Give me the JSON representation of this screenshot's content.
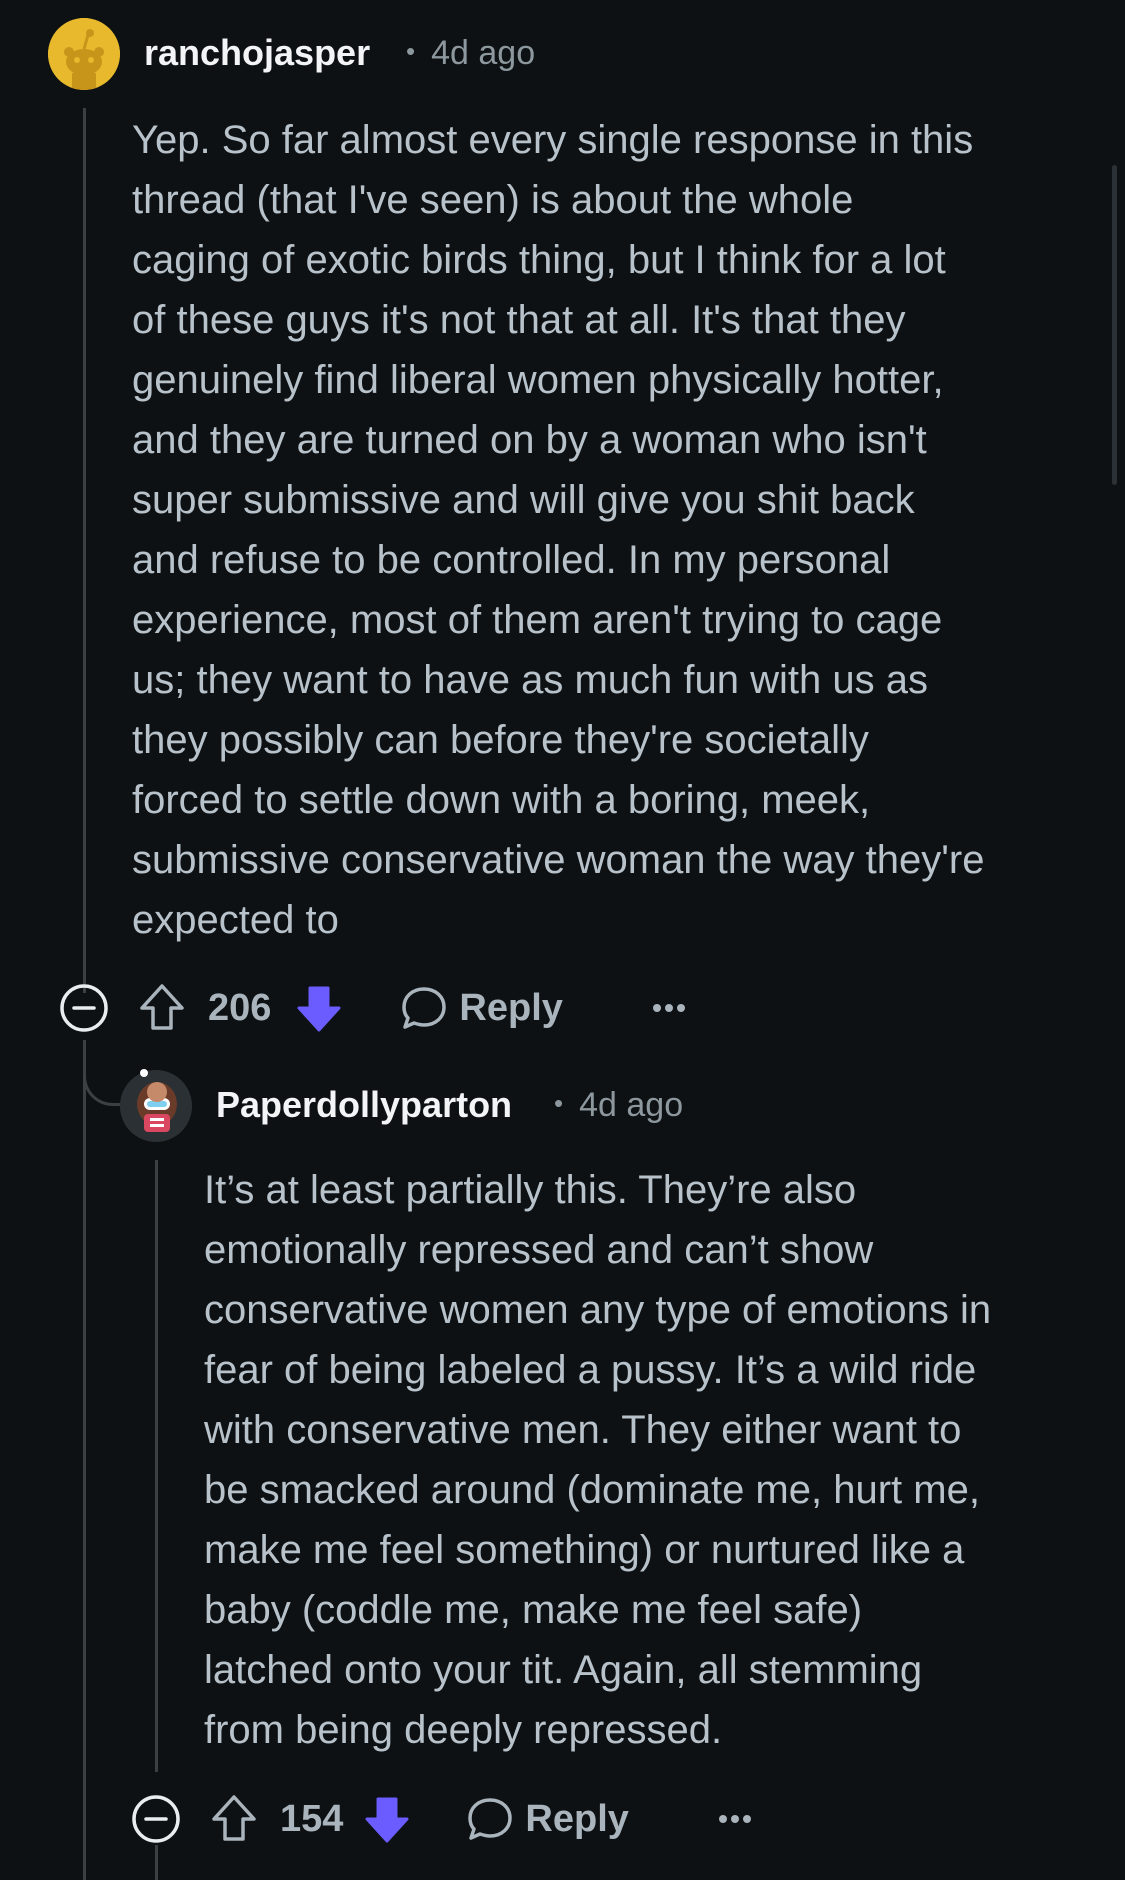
{
  "comments": [
    {
      "username": "ranchojasper",
      "time": "4d ago",
      "lines": [
        "Yep. So far almost every single response in this",
        "thread (that I've seen) is about the whole",
        "caging of exotic birds thing, but I think for a lot",
        "of these guys it's not that at all. It's that they",
        "genuinely find liberal women physically hotter,",
        "and they are turned on by a woman who isn't",
        "super submissive and will give you shit back",
        "and refuse to be controlled. In my personal",
        "experience, most of them aren't trying to cage",
        "us; they want to have as much fun with us as",
        "they possibly can before they're societally",
        "forced to settle down with a boring, meek,",
        "submissive conservative woman the way they're",
        "expected to"
      ],
      "score": "206",
      "reply_label": "Reply",
      "avatar_icon": "snoo-avatar-icon",
      "vote_state": "downvoted"
    },
    {
      "username": "Paperdollyparton",
      "time": "4d ago",
      "lines": [
        "It’s at least partially this. They’re also",
        "emotionally repressed and can’t show",
        "conservative women any type of emotions in",
        "fear of being labeled a pussy. It’s a wild ride",
        "with conservative men. They either want to",
        "be smacked around (dominate me, hurt me,",
        "make me feel something) or nurtured like a",
        "baby (coddle me, make me feel safe)",
        "latched onto your tit. Again, all stemming",
        "from being deeply repressed."
      ],
      "score": "154",
      "reply_label": "Reply",
      "avatar_icon": "custom-avatar-icon",
      "vote_state": "downvoted"
    }
  ],
  "colors": {
    "background": "#0e1113",
    "downvote_active": "#6a5cff",
    "snoo_yellow": "#e8b92c"
  }
}
